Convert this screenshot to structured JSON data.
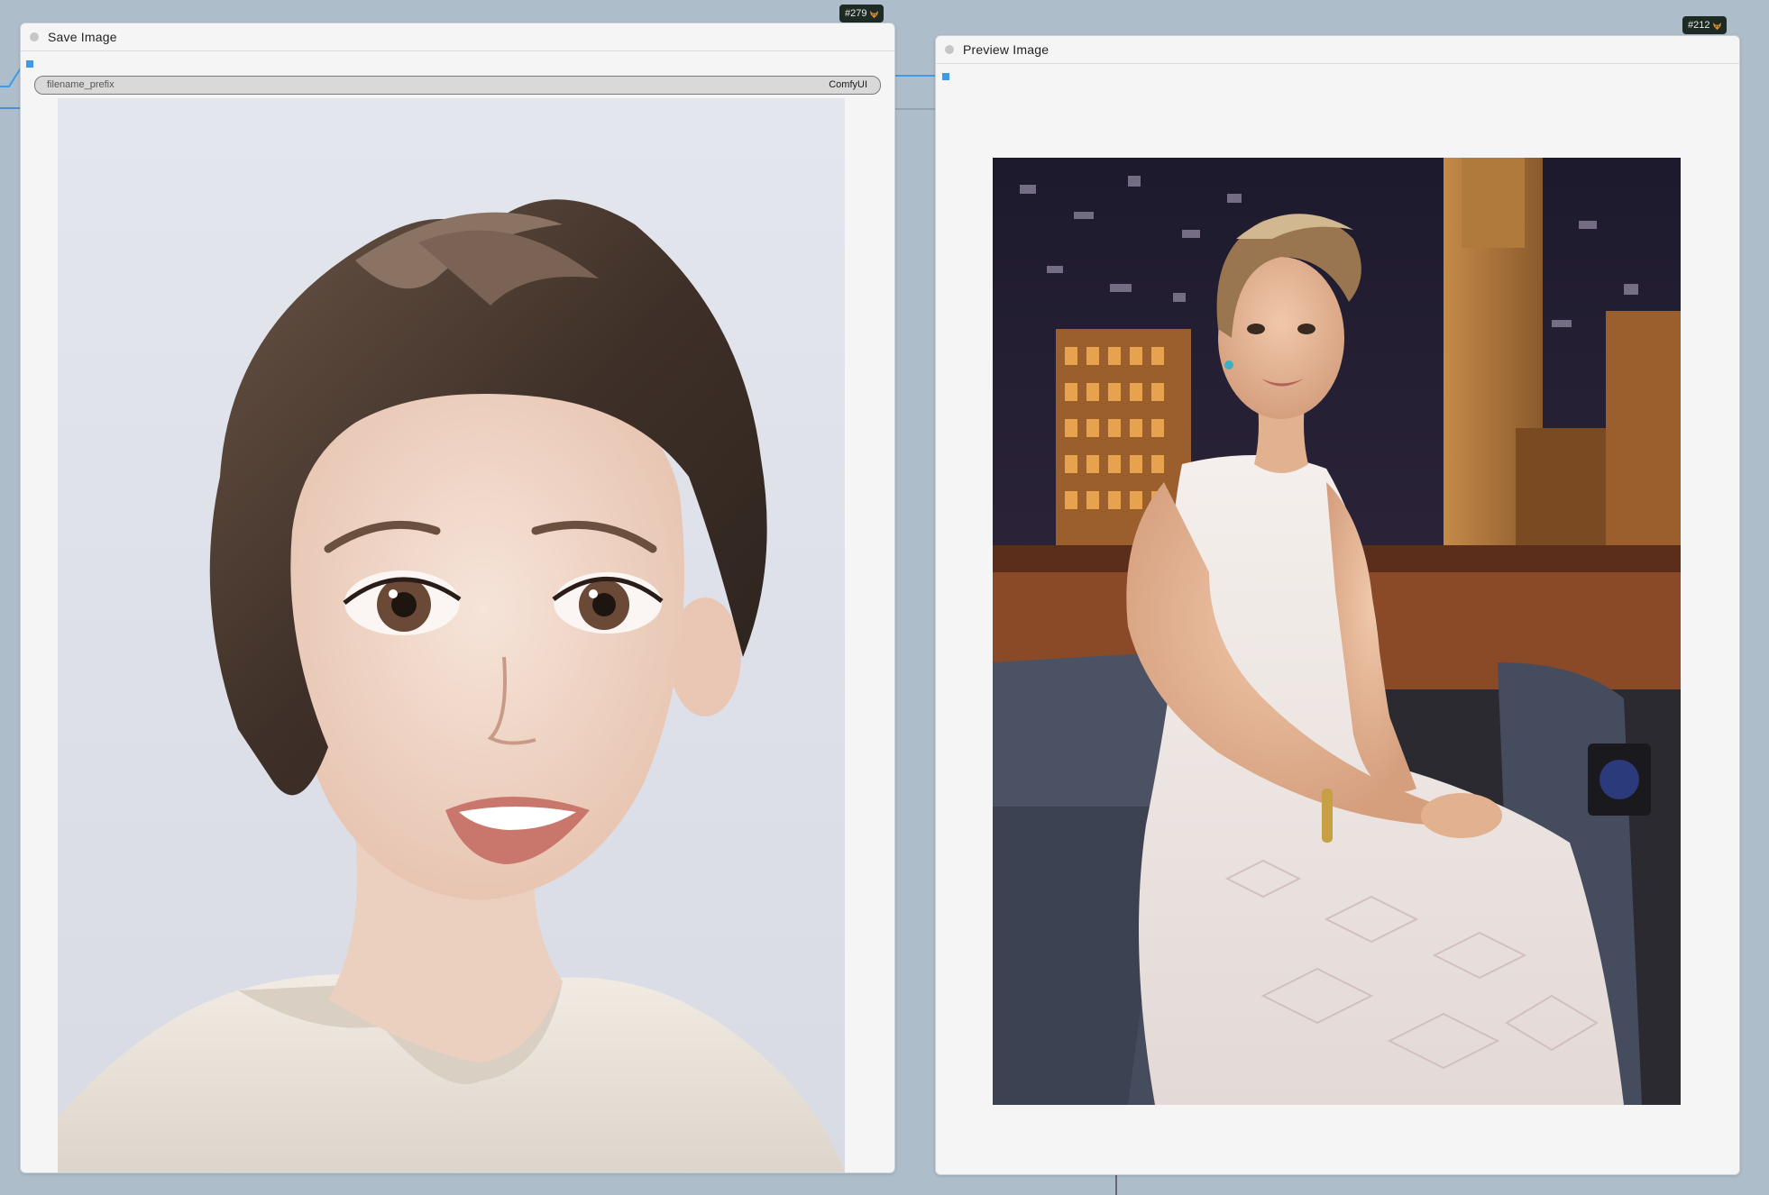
{
  "canvas": {
    "background": "#aebdca",
    "accent": "#3d9be9"
  },
  "save_node": {
    "title": "Save Image",
    "badge": "#279",
    "widget": {
      "label": "filename_prefix",
      "value": "ComfyUI"
    },
    "image_icon": "cartoon-portrait-image"
  },
  "preview_node": {
    "title": "Preview Image",
    "badge": "#212",
    "image_icon": "photo-portrait-image"
  }
}
